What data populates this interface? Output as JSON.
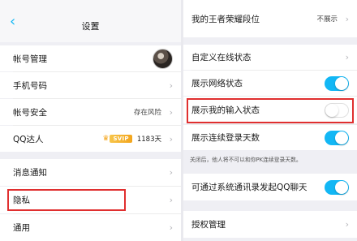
{
  "left": {
    "header": {
      "title": "设置"
    },
    "rows": {
      "account": {
        "label": "帐号管理"
      },
      "phone": {
        "label": "手机号码"
      },
      "security": {
        "label": "帐号安全",
        "value": "存在风险"
      },
      "qq_talent": {
        "label": "QQ达人",
        "badge": "SVIP",
        "value": "1183天"
      },
      "notifications": {
        "label": "消息通知"
      },
      "privacy": {
        "label": "隐私"
      },
      "general": {
        "label": "通用"
      }
    }
  },
  "right": {
    "rows": {
      "rank": {
        "label": "我的王者荣耀段位",
        "value": "不展示"
      },
      "custom_status": {
        "label": "自定义在线状态"
      },
      "network_status": {
        "label": "展示网络状态",
        "on": true
      },
      "typing_status": {
        "label": "展示我的输入状态",
        "on": false
      },
      "login_days": {
        "label": "展示连续登录天数",
        "on": true
      },
      "contacts_chat": {
        "label": "可通过系统通讯录发起QQ聊天",
        "on": true
      },
      "auth_mgmt": {
        "label": "授权管理"
      }
    },
    "hint": "关闭后，他人将不可以和你PK连续登录天数。"
  },
  "colors": {
    "accent": "#12b7f5",
    "highlight": "#e02f2f"
  },
  "icons": {
    "back": "chevron-left-icon",
    "row_arrow": "chevron-right-icon"
  }
}
